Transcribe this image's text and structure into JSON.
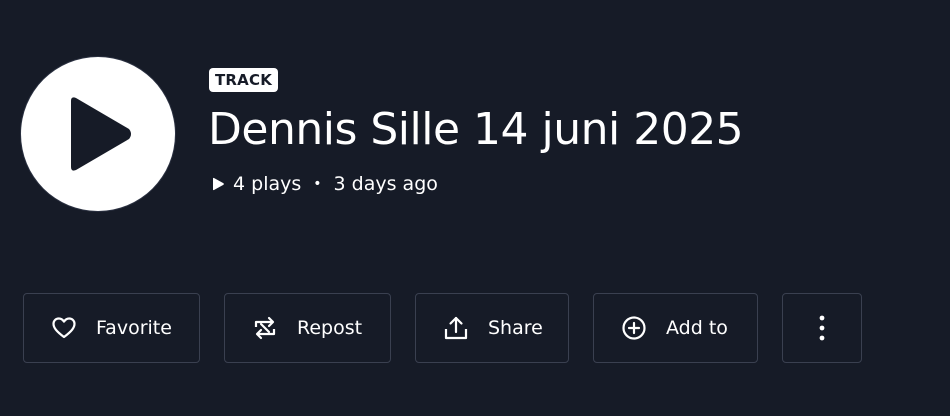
{
  "track": {
    "badge": "TRACK",
    "title": "Dennis Sille 14 juni 2025",
    "plays": "4 plays",
    "separator": "•",
    "posted": "3 days ago"
  },
  "actions": {
    "favorite_label": "Favorite",
    "repost_label": "Repost",
    "share_label": "Share",
    "add_to_label": "Add to"
  },
  "icons": {
    "play": "play-icon",
    "plays": "play-count-icon",
    "favorite": "heart-icon",
    "repost": "repost-icon",
    "share": "share-icon",
    "add_to": "plus-circle-icon",
    "more": "more-vertical-icon"
  },
  "colors": {
    "background": "#161b27",
    "foreground": "#ffffff",
    "button_border": "#3a4050"
  }
}
